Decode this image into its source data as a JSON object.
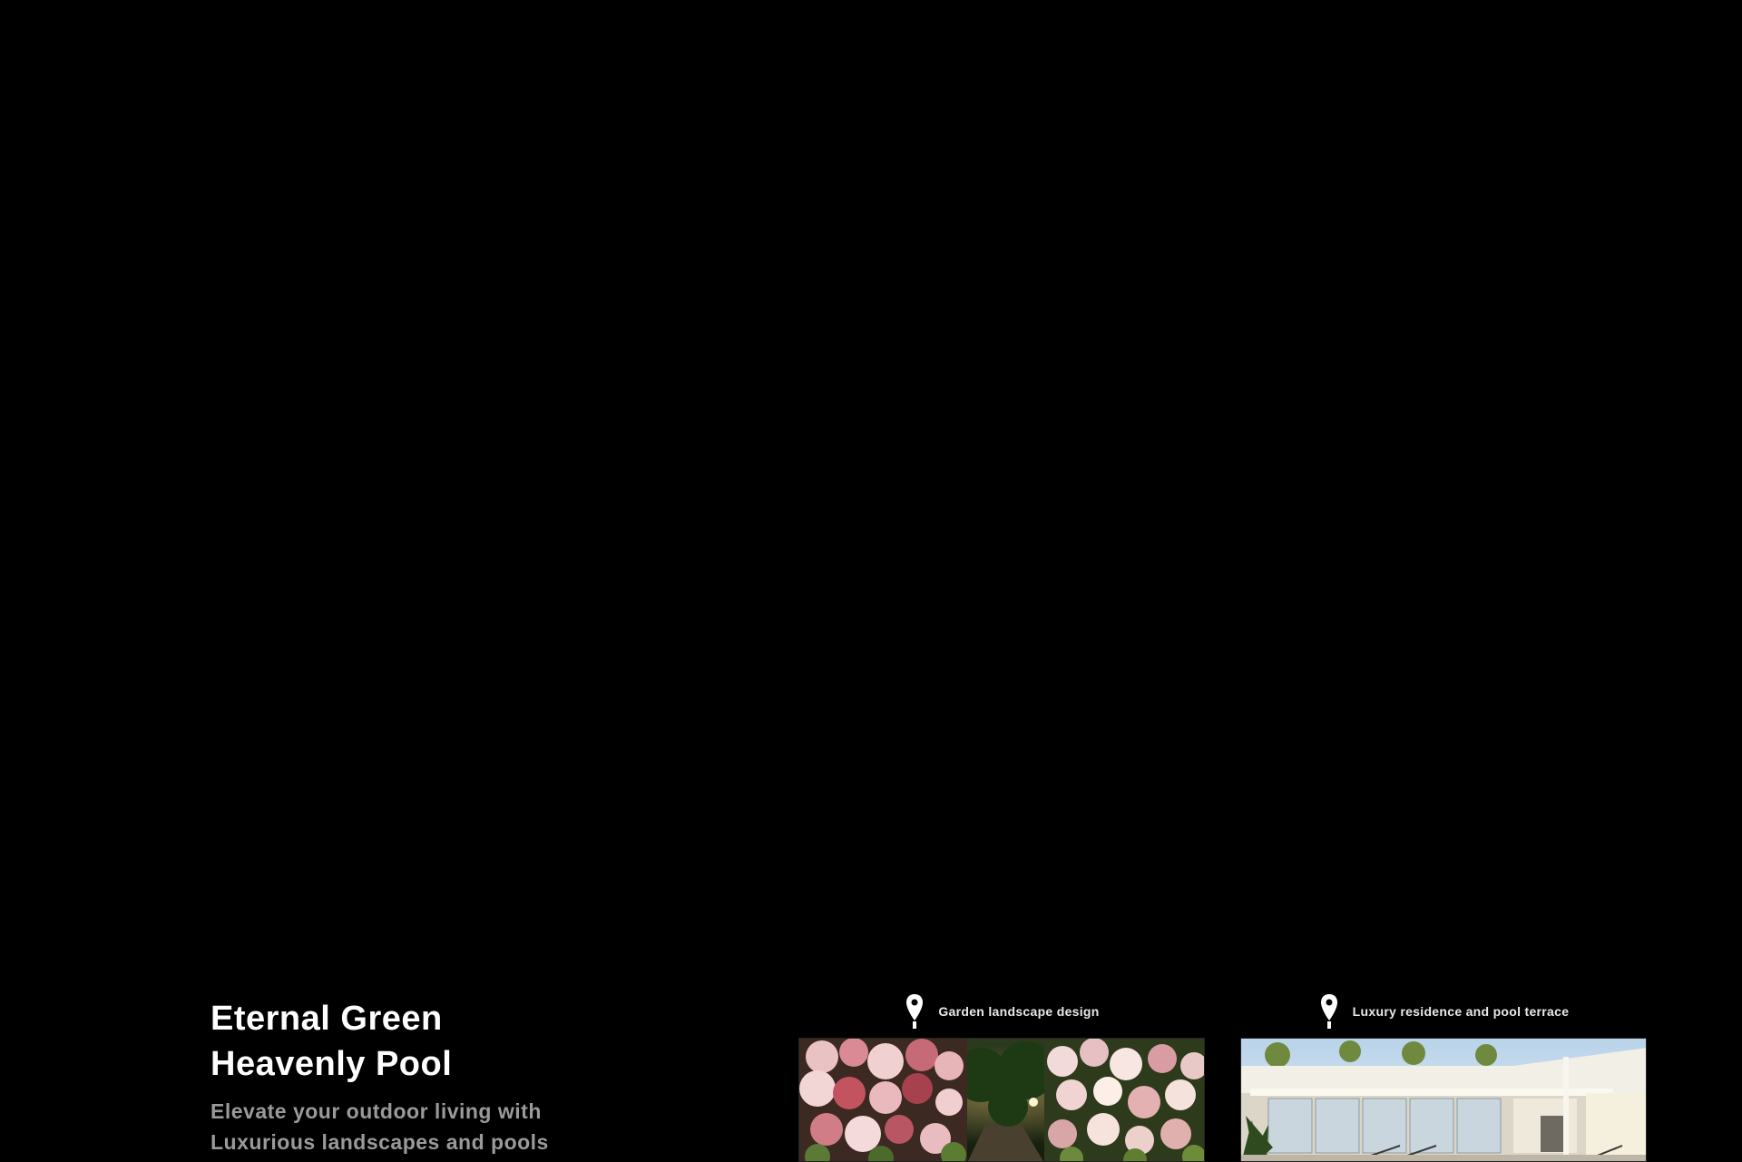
{
  "hero": {
    "title_line1": "Eternal Green",
    "title_line2": "Heavenly Pool",
    "subtitle_line1": "Elevate your outdoor living with",
    "subtitle_line2": "Luxurious landscapes and pools"
  },
  "cards": [
    {
      "caption": "Garden landscape design",
      "icon": "map-pin-icon",
      "image": "rose-garden-path"
    },
    {
      "caption": "Luxury residence and pool terrace",
      "icon": "map-pin-icon",
      "image": "modern-house-patio"
    }
  ],
  "colors": {
    "background": "#000000",
    "title": "#ffffff",
    "subtitle": "#9a9a9a"
  }
}
